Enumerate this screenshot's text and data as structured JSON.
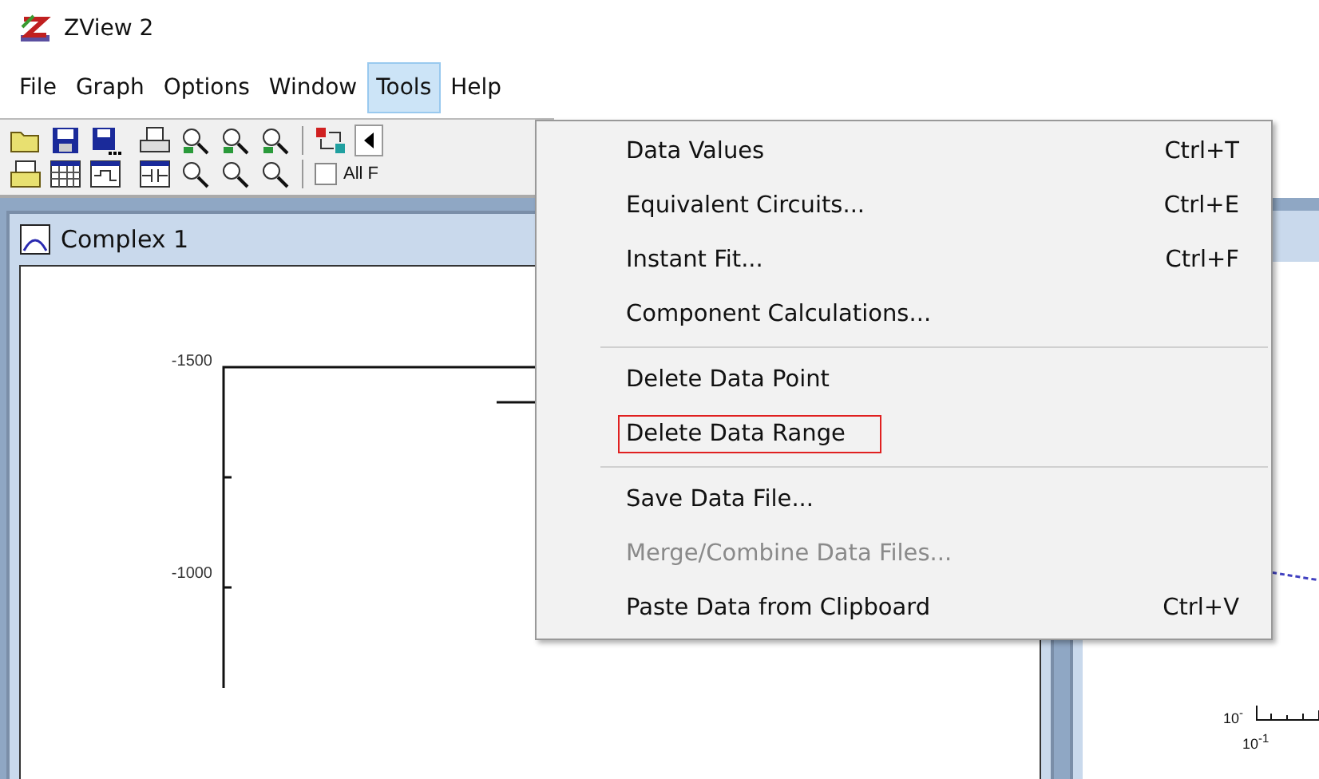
{
  "window": {
    "title": "ZView 2"
  },
  "menubar": [
    {
      "label": "File",
      "selected": false
    },
    {
      "label": "Graph",
      "selected": false
    },
    {
      "label": "Options",
      "selected": false
    },
    {
      "label": "Window",
      "selected": false
    },
    {
      "label": "Tools",
      "selected": true
    },
    {
      "label": "Help",
      "selected": false
    }
  ],
  "toolbar": {
    "all_files_checkbox": {
      "label": "All F",
      "checked": false
    }
  },
  "child_window": {
    "title": "Complex 1",
    "y_tick_labels": [
      "-1500",
      "-1000"
    ]
  },
  "second_window": {
    "axis_labels": [
      "10$^{-}$",
      "10$^{-1}$"
    ]
  },
  "tools_menu": [
    {
      "kind": "item",
      "label": "Data Values",
      "shortcut": "Ctrl+T",
      "disabled": false,
      "outlined": false
    },
    {
      "kind": "item",
      "label": "Equivalent Circuits...",
      "shortcut": "Ctrl+E",
      "disabled": false,
      "outlined": false
    },
    {
      "kind": "item",
      "label": "Instant Fit...",
      "shortcut": "Ctrl+F",
      "disabled": false,
      "outlined": false
    },
    {
      "kind": "item",
      "label": "Component Calculations...",
      "disabled": false,
      "outlined": false
    },
    {
      "kind": "separator"
    },
    {
      "kind": "item",
      "label": "Delete Data Point",
      "disabled": false,
      "outlined": false
    },
    {
      "kind": "item",
      "label": "Delete Data Range",
      "disabled": false,
      "outlined": true
    },
    {
      "kind": "separator"
    },
    {
      "kind": "item",
      "label": "Save Data File...",
      "disabled": false,
      "outlined": false
    },
    {
      "kind": "item",
      "label": "Merge/Combine Data Files...",
      "disabled": true,
      "outlined": false
    },
    {
      "kind": "item",
      "label": "Paste Data from Clipboard",
      "shortcut": "Ctrl+V",
      "disabled": false,
      "outlined": false
    }
  ]
}
